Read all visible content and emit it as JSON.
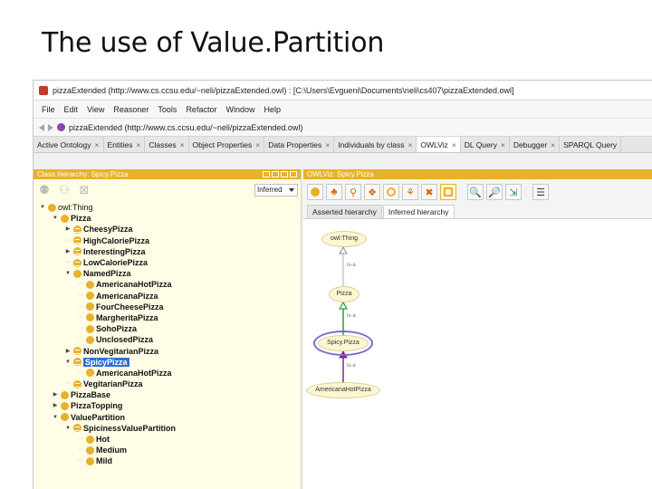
{
  "slide": {
    "title": "The use of Value.Partition"
  },
  "window": {
    "title": "pizzaExtended (http://www.cs.ccsu.edu/~neli/pizzaExtended.owl) : [C:\\Users\\Evgueni\\Documents\\neli\\cs407\\pizzaExtended.owl]"
  },
  "menu": [
    "File",
    "Edit",
    "View",
    "Reasoner",
    "Tools",
    "Refactor",
    "Window",
    "Help"
  ],
  "address": {
    "text": "pizzaExtended (http://www.cs.ccsu.edu/~neli/pizzaExtended.owl)"
  },
  "tabs": [
    {
      "label": "Active Ontology"
    },
    {
      "label": "Entities"
    },
    {
      "label": "Classes"
    },
    {
      "label": "Object Properties"
    },
    {
      "label": "Data Properties"
    },
    {
      "label": "Individuals by class"
    },
    {
      "label": "OWLViz"
    },
    {
      "label": "DL Query"
    },
    {
      "label": "Debugger"
    },
    {
      "label": "SPARQL Query"
    }
  ],
  "left_panel": {
    "header": "Class hierarchy: Spicy.Pizza",
    "reasoner": "Inferred"
  },
  "tree": [
    {
      "label": "owl:Thing"
    },
    {
      "label": "Pizza"
    },
    {
      "label": "CheesyPizza"
    },
    {
      "label": "HighCaloriePizza"
    },
    {
      "label": "InterestingPizza"
    },
    {
      "label": "LowCaloriePizza"
    },
    {
      "label": "NamedPizza"
    },
    {
      "label": "AmericanaHotPizza"
    },
    {
      "label": "AmericanaPizza"
    },
    {
      "label": "FourCheesePizza"
    },
    {
      "label": "MargheritaPizza"
    },
    {
      "label": "SohoPizza"
    },
    {
      "label": "UnclosedPizza"
    },
    {
      "label": "NonVegitarianPizza"
    },
    {
      "label": "SpicyPizza"
    },
    {
      "label": "AmericanaHotPizza"
    },
    {
      "label": "VegitarianPizza"
    },
    {
      "label": "PizzaBase"
    },
    {
      "label": "PizzaTopping"
    },
    {
      "label": "ValuePartition"
    },
    {
      "label": "SpicinessValuePartition"
    },
    {
      "label": "Hot"
    },
    {
      "label": "Medium"
    },
    {
      "label": "Mild"
    }
  ],
  "right_panel": {
    "header": "OWLViz: Spicy.Pizza",
    "subtabs": [
      "Asserted hierarchy",
      "Inferred hierarchy"
    ]
  },
  "graph": {
    "nodes": [
      "owl:Thing",
      "Pizza",
      "Spicy.Pizza",
      "AmericanaHotPizza"
    ],
    "edge_label": "is-a"
  },
  "colors": {
    "accent": "#e8b12a",
    "selection": "#2f6fd6",
    "tree_bg": "#fffde6"
  }
}
